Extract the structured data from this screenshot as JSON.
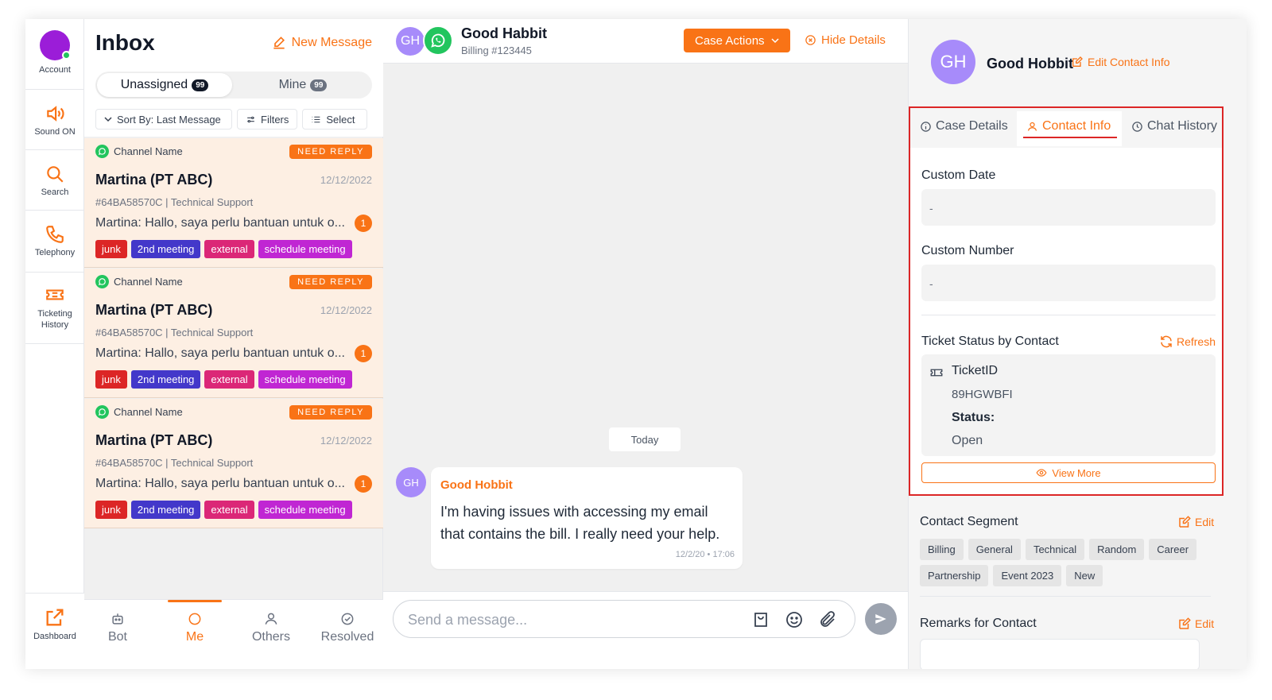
{
  "rail": {
    "account": "Account",
    "sound": "Sound ON",
    "search": "Search",
    "telephony": "Telephony",
    "ticketing": "Ticketing History",
    "dashboard": "Dashboard"
  },
  "inbox": {
    "title": "Inbox",
    "new_message": "New Message",
    "tabs": [
      {
        "label": "Unassigned",
        "count": "99"
      },
      {
        "label": "Mine",
        "count": "99"
      }
    ],
    "filters": {
      "sort": "Sort By: Last Message",
      "filters": "Filters",
      "select": "Select"
    },
    "conversations": [
      {
        "channel": "Channel Name",
        "badge": "NEED REPLY",
        "name": "Martina (PT ABC)",
        "date": "12/12/2022",
        "ticket": "#64BA58570C | Technical Support",
        "preview": "Martina:  Hallo, saya perlu bantuan untuk o...",
        "unread": "1",
        "tags": [
          {
            "label": "junk",
            "color": "#dc2626"
          },
          {
            "label": "2nd meeting",
            "color": "#4338ca"
          },
          {
            "label": "external",
            "color": "#db2777"
          },
          {
            "label": "schedule meeting",
            "color": "#c026d3"
          }
        ]
      },
      {
        "channel": "Channel Name",
        "badge": "NEED REPLY",
        "name": "Martina (PT ABC)",
        "date": "12/12/2022",
        "ticket": "#64BA58570C | Technical Support",
        "preview": "Martina:  Hallo, saya perlu bantuan untuk o...",
        "unread": "1",
        "tags": [
          {
            "label": "junk",
            "color": "#dc2626"
          },
          {
            "label": "2nd meeting",
            "color": "#4338ca"
          },
          {
            "label": "external",
            "color": "#db2777"
          },
          {
            "label": "schedule meeting",
            "color": "#c026d3"
          }
        ]
      },
      {
        "channel": "Channel Name",
        "badge": "NEED REPLY",
        "name": "Martina (PT ABC)",
        "date": "12/12/2022",
        "ticket": "#64BA58570C | Technical Support",
        "preview": "Martina:  Hallo, saya perlu bantuan untuk o...",
        "unread": "1",
        "tags": [
          {
            "label": "junk",
            "color": "#dc2626"
          },
          {
            "label": "2nd meeting",
            "color": "#4338ca"
          },
          {
            "label": "external",
            "color": "#db2777"
          },
          {
            "label": "schedule meeting",
            "color": "#c026d3"
          }
        ]
      }
    ],
    "bottom_nav": [
      "Bot",
      "Me",
      "Others",
      "Resolved"
    ]
  },
  "chat": {
    "avatar": "GH",
    "name": "Good Habbit",
    "subtitle": "Billing #123445",
    "case_actions": "Case Actions",
    "hide_details": "Hide Details",
    "divider": "Today",
    "message": {
      "avatar": "GH",
      "from": "Good Hobbit",
      "text": "I'm having issues with accessing my email that contains the bill. I really need your help.",
      "time": "12/2/20 • 17:06"
    },
    "composer_placeholder": "Send a message..."
  },
  "details": {
    "avatar": "GH",
    "name": "Good Hobbit",
    "edit_contact": "Edit Contact Info",
    "tabs": [
      "Case Details",
      "Contact Info",
      "Chat History"
    ],
    "custom_date_label": "Custom Date",
    "custom_date_value": "-",
    "custom_number_label": "Custom Number",
    "custom_number_value": "-",
    "ticket_status_label": "Ticket Status by Contact",
    "refresh": "Refresh",
    "ticket": {
      "id_label": "TicketID",
      "id_value": "89HGWBFI",
      "status_label": "Status:",
      "status_value": "Open"
    },
    "view_more": "View More",
    "segment_label": "Contact Segment",
    "edit": "Edit",
    "segments": [
      "Billing",
      "General",
      "Technical",
      "Random",
      "Career",
      "Partnership",
      "Event 2023",
      "New"
    ],
    "remarks_label": "Remarks for Contact"
  },
  "colors": {
    "accent": "#f97316",
    "whatsapp": "#22c55e",
    "highlight_border": "#dc2626"
  }
}
